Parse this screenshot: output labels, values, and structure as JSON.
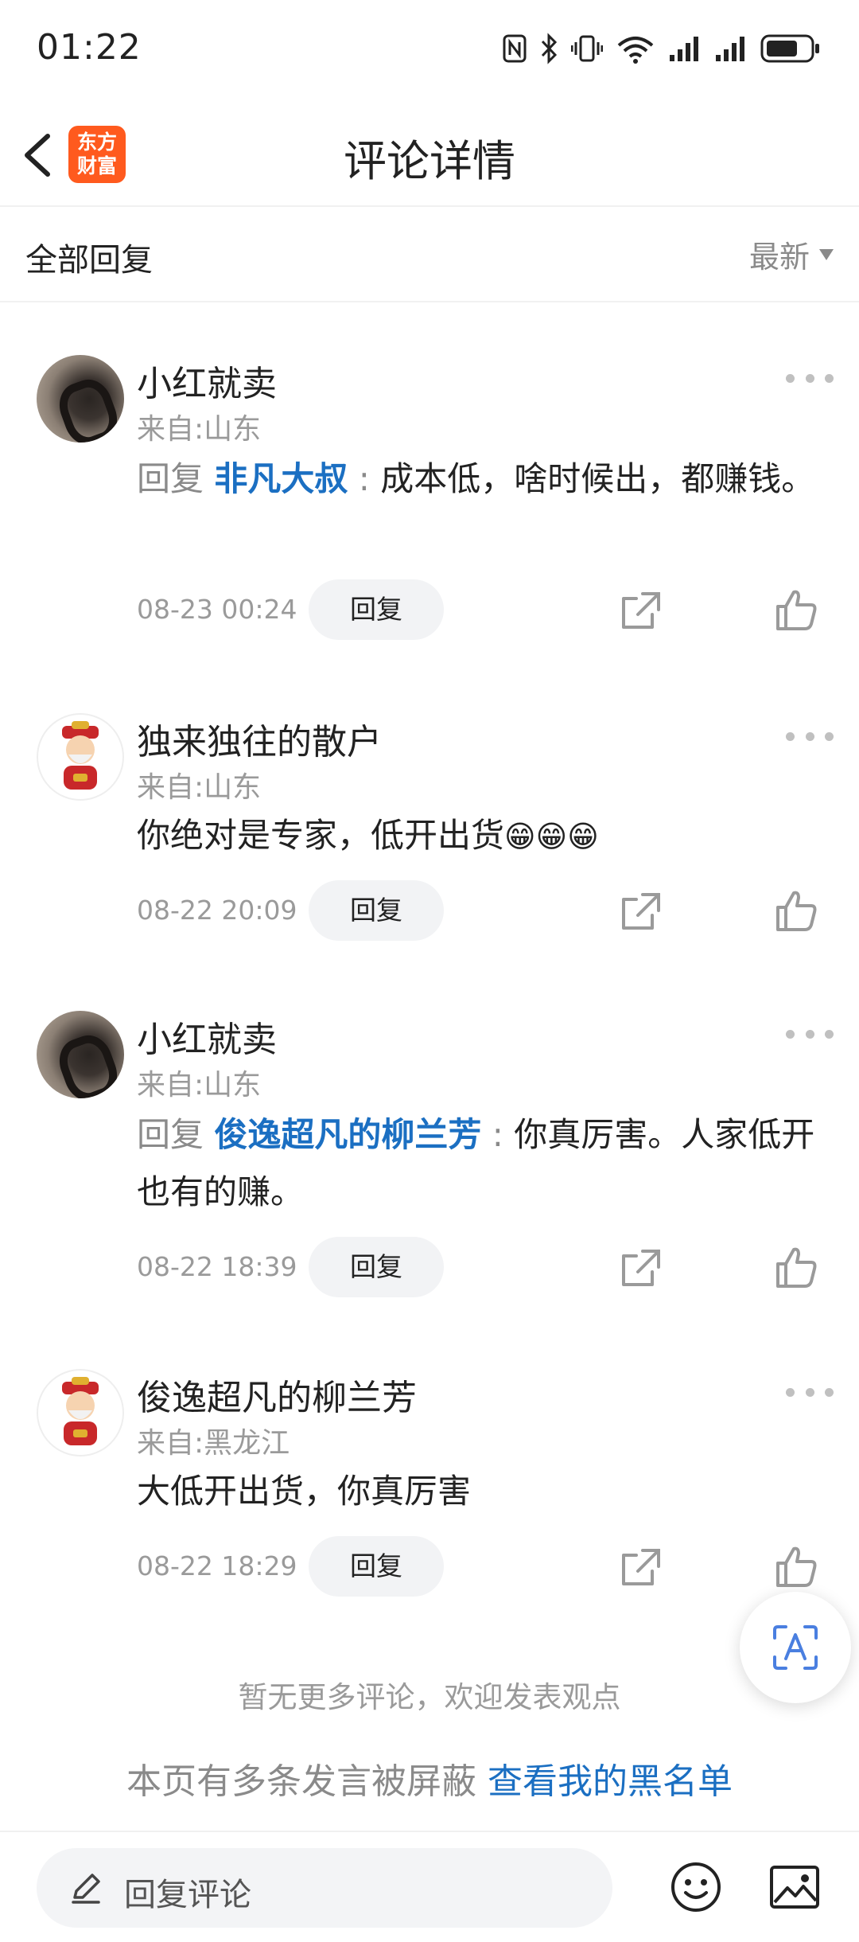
{
  "status_bar": {
    "time": "01:22"
  },
  "header": {
    "title": "评论详情",
    "logo_line1": "东方",
    "logo_line2": "财富"
  },
  "filter": {
    "title": "全部回复",
    "sort_label": "最新"
  },
  "comments": [
    {
      "name": "小红就卖",
      "location": "来自:山东",
      "reply_prefix": "回复",
      "reply_target": "非凡大叔",
      "reply_sep": ":",
      "text": "成本低，啥时候出，都赚钱。",
      "time": "08-23 00:24",
      "reply_label": "回复"
    },
    {
      "name": "独来独往的散户",
      "location": "来自:山东",
      "text": "你绝对是专家，低开出货",
      "emoji": "😁😁😁",
      "time": "08-22 20:09",
      "reply_label": "回复"
    },
    {
      "name": "小红就卖",
      "location": "来自:山东",
      "reply_prefix": "回复",
      "reply_target": "俊逸超凡的柳兰芳",
      "reply_sep": ":",
      "text": "你真厉害。人家低开也有的赚。",
      "time": "08-22 18:39",
      "reply_label": "回复"
    },
    {
      "name": "俊逸超凡的柳兰芳",
      "location": "来自:黑龙江",
      "text": "大低开出货，你真厉害",
      "time": "08-22 18:29",
      "reply_label": "回复"
    }
  ],
  "end_note": "暂无更多评论，欢迎发表观点",
  "blocked": {
    "text": "本页有多条发言被屏蔽",
    "link": "查看我的黑名单"
  },
  "bottom_bar": {
    "placeholder": "回复评论"
  },
  "colors": {
    "accent_blue": "#1b6fc2",
    "logo_orange": "#ff5a1e"
  }
}
